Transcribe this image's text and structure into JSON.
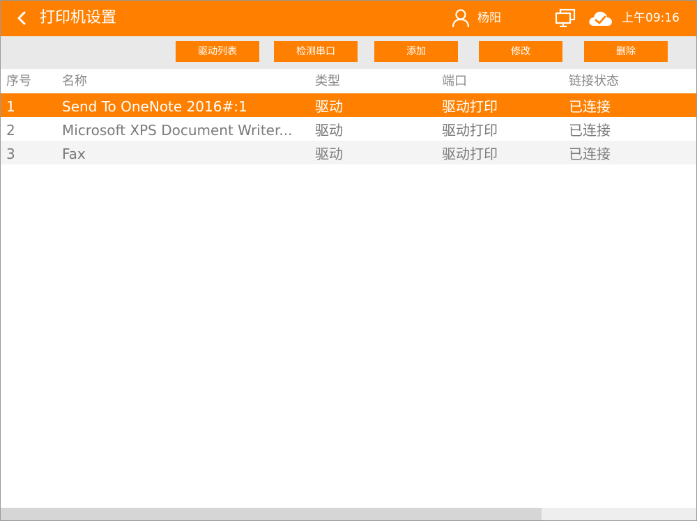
{
  "header": {
    "title": "打印机设置",
    "user_name": "杨阳",
    "time": "上午09:16",
    "icons": [
      "back-arrow-icon",
      "user-icon",
      "monitor-icon",
      "cloud-check-icon"
    ],
    "accent_color": "#ff8000"
  },
  "toolbar": {
    "buttons": [
      {
        "label": "驱动列表"
      },
      {
        "label": "检测串口"
      },
      {
        "label": "添加"
      },
      {
        "label": "修改"
      },
      {
        "label": "删除"
      }
    ]
  },
  "table": {
    "columns": [
      "序号",
      "名称",
      "类型",
      "端口",
      "链接状态"
    ],
    "rows": [
      {
        "no": "1",
        "name": "Send To OneNote 2016#:1",
        "type": "驱动",
        "port": "驱动打印",
        "status": "已连接",
        "selected": true
      },
      {
        "no": "2",
        "name": "Microsoft XPS Document Writer...",
        "type": "驱动",
        "port": "驱动打印",
        "status": "已连接",
        "selected": false
      },
      {
        "no": "3",
        "name": "Fax",
        "type": "驱动",
        "port": "驱动打印",
        "status": "已连接",
        "selected": false
      }
    ]
  }
}
